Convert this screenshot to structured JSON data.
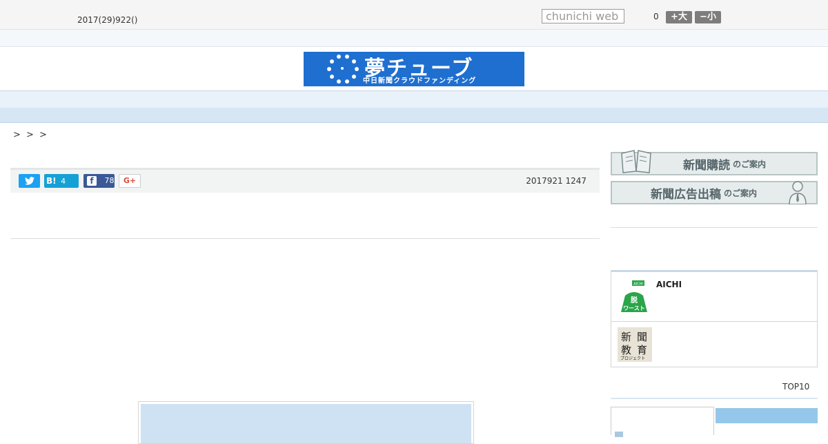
{
  "header": {
    "date_text": "2017(29)922()",
    "search_placeholder": "chunichi web",
    "count_text": "0",
    "font_large_label": "+大",
    "font_small_label": "−小"
  },
  "banner": {
    "title": "夢チューブ",
    "subtitle": "中日新聞クラウドファンディング"
  },
  "nav": {
    "items": [
      "",
      "",
      "",
      "",
      "",
      "",
      "",
      "",
      ""
    ]
  },
  "breadcrumb": {
    "text": "> > >"
  },
  "share": {
    "twitter_icon": "twitter-icon",
    "hatena_label": "B!",
    "hatena_count": "4",
    "facebook_label": "f",
    "facebook_count": "78",
    "gplus_label": "G+",
    "published": "2017921 1247"
  },
  "sidebar": {
    "subscribe_main": "新聞購読",
    "subscribe_small": "のご案内",
    "ad_main": "新聞広告出稿",
    "ad_small": "のご案内",
    "aichi_label": "AICHI",
    "aichi_logo_text": "脱ワースト",
    "edu_chars": [
      "新",
      "聞",
      "教",
      "育"
    ],
    "edu_sub": "プロジェクト",
    "top10_label": "TOP10"
  },
  "colors": {
    "banner_blue": "#1e6fd0",
    "nav_bg": "#e9f1fa",
    "tab_active": "#94c7e9"
  }
}
